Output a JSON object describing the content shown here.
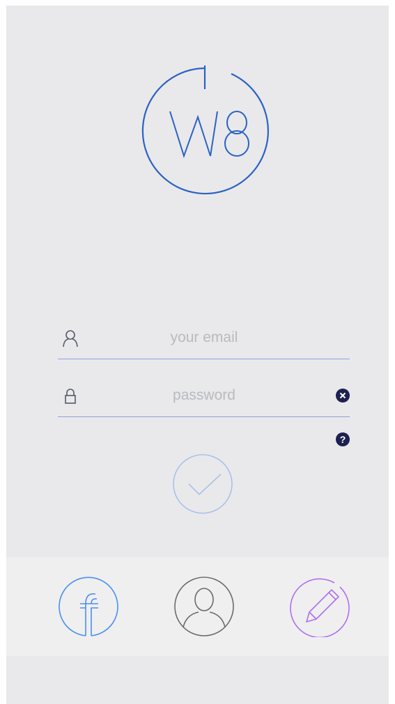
{
  "logo": {
    "icon": "w8-logo-icon",
    "color": "#2b62c4"
  },
  "login": {
    "email": {
      "placeholder": "your email",
      "value": "",
      "icon": "user-icon"
    },
    "password": {
      "placeholder": "password",
      "value": "",
      "icon": "lock-icon",
      "clear_icon": "close-icon"
    },
    "help": {
      "label": "?",
      "icon": "question-icon"
    },
    "submit": {
      "icon": "checkmark-icon",
      "color": "#a9c1ea"
    }
  },
  "bottom_bar": {
    "buttons": [
      {
        "icon": "facebook-icon",
        "color": "#4a8ef0"
      },
      {
        "icon": "profile-icon",
        "color": "#6b6b6b"
      },
      {
        "icon": "pencil-icon",
        "color": "#b06ef0"
      }
    ]
  },
  "colors": {
    "background": "#e9e9eb",
    "bottom_bar": "#efeff0",
    "field_line": "#8ea2dc",
    "dark_badge": "#1d2050",
    "placeholder": "#b8bac0"
  }
}
